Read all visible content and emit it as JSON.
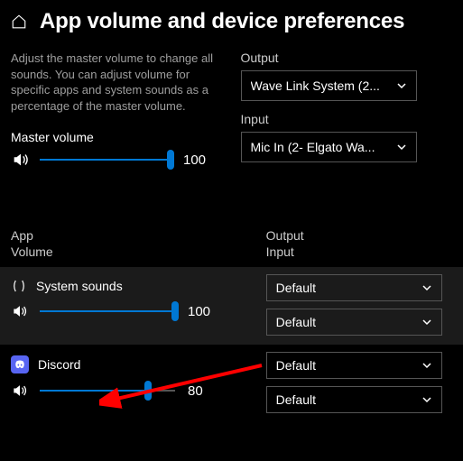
{
  "header": {
    "title": "App volume and device preferences"
  },
  "description": "Adjust the master volume to change all sounds. You can adjust volume for specific apps and system sounds as a percentage of the master volume.",
  "master": {
    "label": "Master volume",
    "value": "100"
  },
  "output": {
    "label": "Output",
    "selected": "Wave Link System (2..."
  },
  "input": {
    "label": "Input",
    "selected": "Mic In (2- Elgato Wa..."
  },
  "columns": {
    "left1": "App",
    "left2": "Volume",
    "right1": "Output",
    "right2": "Input"
  },
  "apps": {
    "system": {
      "name": "System sounds",
      "volume": "100",
      "output": "Default",
      "input": "Default"
    },
    "discord": {
      "name": "Discord",
      "volume": "80",
      "output": "Default",
      "input": "Default"
    }
  }
}
